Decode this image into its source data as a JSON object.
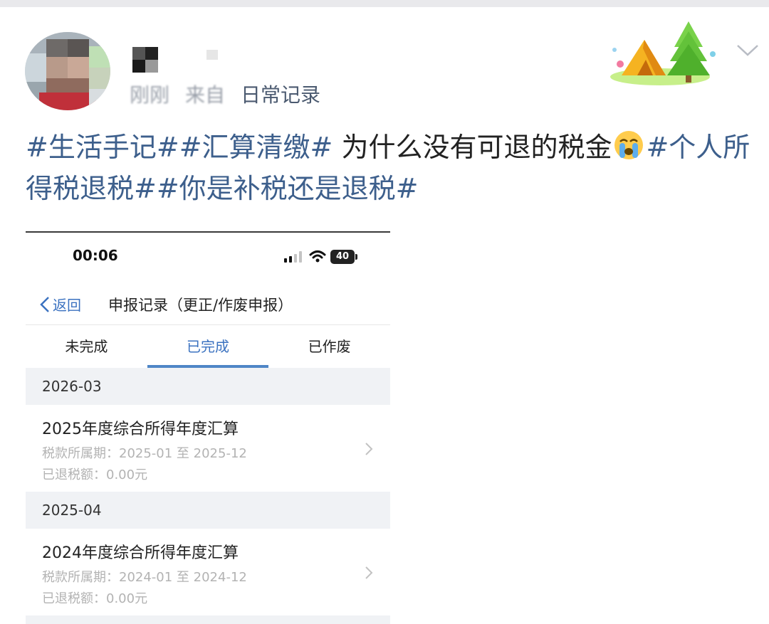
{
  "post": {
    "time": "刚刚",
    "source": "来自",
    "topic": "日常记录",
    "text": {
      "tag1": "#生活手记#",
      "tag2": "#汇算清缴#",
      "body": " 为什么没有可退的税金",
      "tag3": "#个人所得税退税#",
      "tag4": "#你是补税还是退税#"
    },
    "emoji": "crying-face-icon",
    "decoration": "camping-tent-tree-icon"
  },
  "screenshot": {
    "status_bar": {
      "time": "00:06",
      "battery": "40"
    },
    "nav": {
      "back_label": "返回",
      "title": "申报记录（更正/作废申报）"
    },
    "tabs": [
      {
        "label": "未完成",
        "active": false
      },
      {
        "label": "已完成",
        "active": true
      },
      {
        "label": "已作废",
        "active": false
      }
    ],
    "groups": [
      {
        "month": "2026-03",
        "record": {
          "title": "2025年度综合所得年度汇算",
          "period": "税款所属期：2025-01 至 2025-12",
          "refund": "已退税额：0.00元"
        }
      },
      {
        "month": "2025-04",
        "record": {
          "title": "2024年度综合所得年度汇算",
          "period": "税款所属期：2024-01 至 2024-12",
          "refund": "已退税额：0.00元"
        }
      }
    ]
  },
  "colors": {
    "tag_blue": "#3d5f8c",
    "tab_active": "#3b72c0",
    "group_bg": "#f0f2f5"
  }
}
